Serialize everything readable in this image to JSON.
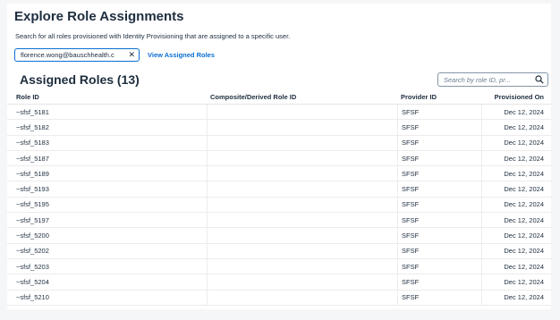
{
  "page": {
    "title": "Explore Role Assignments",
    "description": "Search for all roles provisioned with Identity Provisioning that are assigned to a specific user."
  },
  "user_filter": {
    "token": "florence.wong@bauschhealth.c",
    "clear_icon": "close-icon",
    "view_link": "View Assigned Roles"
  },
  "table": {
    "title": "Assigned Roles (13)",
    "search": {
      "placeholder": "Search by role ID, pr...",
      "icon": "search-icon"
    },
    "columns": [
      "Role ID",
      "Composite/Derived Role ID",
      "Provider ID",
      "Provisioned On"
    ],
    "rows": [
      {
        "role_id": "~sfsf_5181",
        "composite": "",
        "provider": "SFSF",
        "provisioned": "Dec 12, 2024"
      },
      {
        "role_id": "~sfsf_5182",
        "composite": "",
        "provider": "SFSF",
        "provisioned": "Dec 12, 2024"
      },
      {
        "role_id": "~sfsf_5183",
        "composite": "",
        "provider": "SFSF",
        "provisioned": "Dec 12, 2024"
      },
      {
        "role_id": "~sfsf_5187",
        "composite": "",
        "provider": "SFSF",
        "provisioned": "Dec 12, 2024"
      },
      {
        "role_id": "~sfsf_5189",
        "composite": "",
        "provider": "SFSF",
        "provisioned": "Dec 12, 2024"
      },
      {
        "role_id": "~sfsf_5193",
        "composite": "",
        "provider": "SFSF",
        "provisioned": "Dec 12, 2024"
      },
      {
        "role_id": "~sfsf_5195",
        "composite": "",
        "provider": "SFSF",
        "provisioned": "Dec 12, 2024"
      },
      {
        "role_id": "~sfsf_5197",
        "composite": "",
        "provider": "SFSF",
        "provisioned": "Dec 12, 2024"
      },
      {
        "role_id": "~sfsf_5200",
        "composite": "",
        "provider": "SFSF",
        "provisioned": "Dec 12, 2024"
      },
      {
        "role_id": "~sfsf_5202",
        "composite": "",
        "provider": "SFSF",
        "provisioned": "Dec 12, 2024"
      },
      {
        "role_id": "~sfsf_5203",
        "composite": "",
        "provider": "SFSF",
        "provisioned": "Dec 12, 2024"
      },
      {
        "role_id": "~sfsf_5204",
        "composite": "",
        "provider": "SFSF",
        "provisioned": "Dec 12, 2024"
      },
      {
        "role_id": "~sfsf_5210",
        "composite": "",
        "provider": "SFSF",
        "provisioned": "Dec 12, 2024"
      }
    ]
  },
  "colors": {
    "accent": "#0a6ed1",
    "text": "#1d2d3e",
    "background": "#f5f6f7"
  }
}
